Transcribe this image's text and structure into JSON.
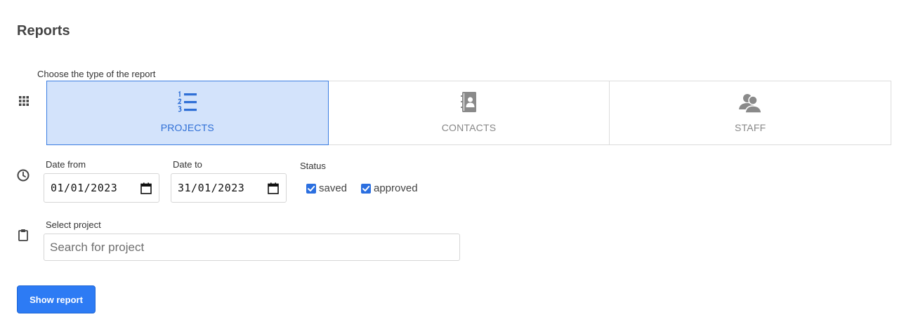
{
  "page": {
    "title": "Reports"
  },
  "report_type": {
    "label": "Choose the type of the report",
    "options": [
      {
        "label": "PROJECTS",
        "icon": "numbered-list-icon",
        "active": true
      },
      {
        "label": "CONTACTS",
        "icon": "contacts-book-icon",
        "active": false
      },
      {
        "label": "STAFF",
        "icon": "users-icon",
        "active": false
      }
    ]
  },
  "dates": {
    "from_label": "Date from",
    "from_value": "01/01/2023",
    "to_label": "Date to",
    "to_value": "31/01/2023"
  },
  "status": {
    "label": "Status",
    "options": [
      {
        "label": "saved",
        "checked": true
      },
      {
        "label": "approved",
        "checked": true
      }
    ]
  },
  "project": {
    "label": "Select project",
    "placeholder": "Search for project",
    "value": ""
  },
  "actions": {
    "show_report_label": "Show report"
  },
  "colors": {
    "accent": "#2d7bf4",
    "active_bg": "#d3e3fb",
    "active_text": "#2f6fd6",
    "inactive_icon": "#8a8a8a"
  }
}
